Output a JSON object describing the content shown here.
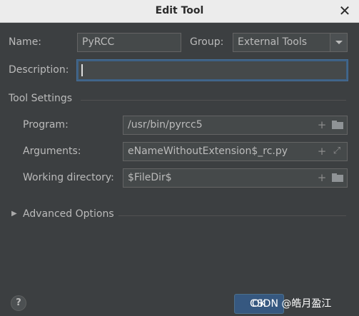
{
  "window": {
    "title": "Edit Tool"
  },
  "form": {
    "name_label": "Name:",
    "name_value": "PyRCC",
    "group_label": "Group:",
    "group_value": "External Tools",
    "description_label": "Description:",
    "description_value": ""
  },
  "tool_settings": {
    "section_label": "Tool Settings",
    "program_label": "Program:",
    "program_value": "/usr/bin/pyrcc5",
    "arguments_label": "Arguments:",
    "arguments_value": "eNameWithoutExtension$_rc.py",
    "working_dir_label": "Working directory:",
    "working_dir_value": "$FileDir$"
  },
  "advanced": {
    "label": "Advanced Options"
  },
  "footer": {
    "help_label": "?",
    "ok_label": "OK",
    "watermark": "CSDN @皓月盈江"
  },
  "icons": {
    "close": "close-icon",
    "add": "plus-icon",
    "folder": "folder-icon",
    "expand_field": "expand-icon",
    "dropdown": "chevron-down-icon",
    "disclosure": "triangle-right-icon"
  },
  "colors": {
    "background": "#3c3f41",
    "field_bg": "#45494a",
    "focus_border": "#3d6185",
    "ok_button": "#365880",
    "titlebar": "#ececec"
  }
}
